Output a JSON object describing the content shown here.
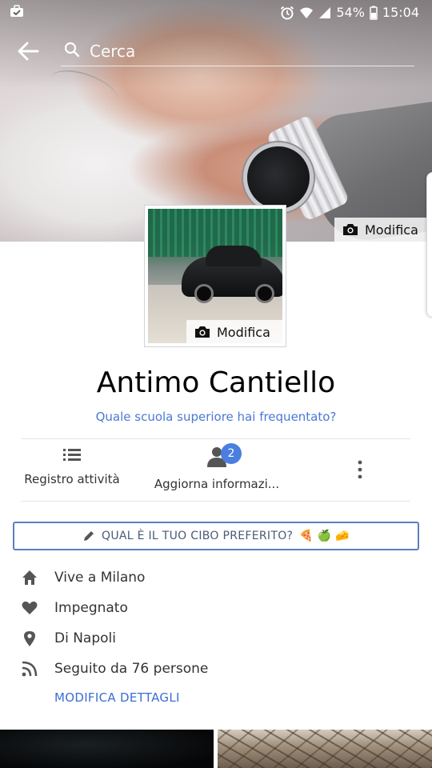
{
  "status_bar": {
    "battery": "54%",
    "time": "15:04"
  },
  "header": {
    "search_placeholder": "Cerca"
  },
  "cover": {
    "edit_label": "Modifica"
  },
  "profile": {
    "edit_photo_label": "Modifica",
    "name": "Antimo Cantiello",
    "school_prompt": "Quale scuola superiore hai frequentato?"
  },
  "actions": {
    "activity_log": "Registro attività",
    "update_info": "Aggiorna informazi...",
    "update_info_badge": "2"
  },
  "food_prompt": {
    "text": "QUAL È IL TUO CIBO PREFERITO?",
    "emojis": "🍕 🍏 🧀"
  },
  "details": [
    {
      "icon": "home-icon",
      "text": "Vive a Milano"
    },
    {
      "icon": "heart-icon",
      "text": "Impegnato"
    },
    {
      "icon": "location-pin-icon",
      "text": "Di Napoli"
    },
    {
      "icon": "rss-icon",
      "text": "Seguito da 76 persone"
    }
  ],
  "edit_details_label": "MODIFICA DETTAGLI",
  "colors": {
    "link_blue": "#4b78d4",
    "badge_blue": "#4a7fe0",
    "box_border": "#5b7fbd"
  }
}
